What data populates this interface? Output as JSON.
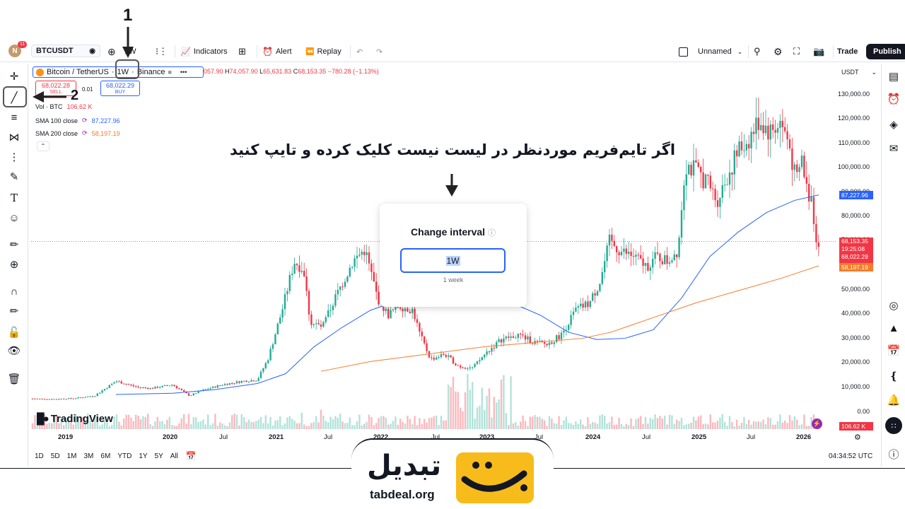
{
  "topbar": {
    "avatar_letter": "N",
    "avatar_badge": "11",
    "symbol": "BTCUSDT",
    "interval": "1W",
    "indicators_label": "Indicators",
    "alert_label": "Alert",
    "replay_label": "Replay",
    "layout_name": "Unnamed",
    "trade_label": "Trade",
    "publish_label": "Publish"
  },
  "legend": {
    "symbol_name": "Bitcoin / TetherUS",
    "interval": "1W",
    "exchange": "Binance",
    "ohlc_open": "057.90",
    "ohlc_high_label": "H",
    "ohlc_high": "74,057.90",
    "ohlc_low_label": "L",
    "ohlc_low": "65,631.83",
    "ohlc_close_label": "C",
    "ohlc_close": "68,153.35",
    "ohlc_change": "−780.28 (−1.13%)",
    "sell_price": "68,022.28",
    "sell_label": "SELL",
    "spread": "0.01",
    "buy_price": "68,022.29",
    "buy_label": "BUY",
    "volume_label": "Vol · BTC",
    "volume_value": "106.62 K",
    "sma100_label": "SMA 100 close",
    "sma100_value": "87,227.96",
    "sma200_label": "SMA 200 close",
    "sma200_value": "58,197.19"
  },
  "price_axis": {
    "currency": "USDT",
    "labels": [
      "130,000.00",
      "120,000.00",
      "110,000.00",
      "100,000.00",
      "90,000.00",
      "80,000.00",
      "70,000.00",
      "50,000.00",
      "40,000.00",
      "30,000.00",
      "20,000.00",
      "10,000.00",
      "0.00"
    ],
    "tag_sma100": "87,227.96",
    "tag_price": "68,153.35",
    "tag_countdown": "19:25:08",
    "tag_bid": "68,022.29",
    "tag_sma200": "58,197.19",
    "tag_volume": "106.62 K"
  },
  "time_axis": {
    "labels": [
      "2019",
      "2020",
      "Jul",
      "2021",
      "Jul",
      "2022",
      "Jul",
      "2023",
      "Jul",
      "2024",
      "Jul",
      "2025",
      "Jul",
      "2026"
    ]
  },
  "bottom": {
    "ranges": [
      "1D",
      "5D",
      "1M",
      "3M",
      "6M",
      "YTD",
      "1Y",
      "5Y",
      "All"
    ],
    "clock": "04:34:52 UTC"
  },
  "watermark": "TradingView",
  "popup": {
    "title": "Change interval",
    "input_value": "1W",
    "hint": "1 week"
  },
  "annotation": {
    "text": "اگر تایم‌فریم موردنظر در لیست نیست کلیک کرده و تایپ کنید",
    "step1": "1",
    "step2": "2"
  },
  "brand": {
    "name_fa": "تبدیل",
    "domain": "tabdeal.org"
  },
  "colors": {
    "up": "#22ab94",
    "down": "#f23645",
    "sma100": "#2962ff",
    "sma200": "#f57c2a",
    "accent": "#2962ff",
    "brand_yellow": "#f7bc1b"
  }
}
